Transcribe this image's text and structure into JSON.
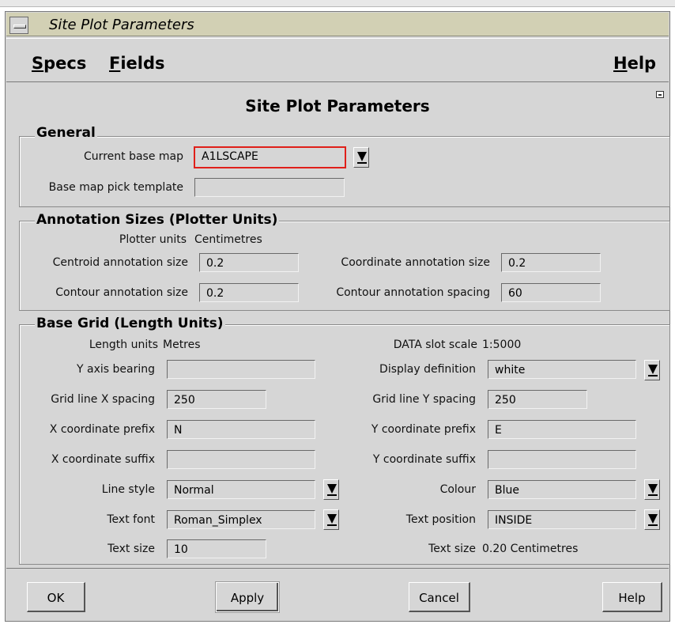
{
  "window": {
    "title": "Site Plot Parameters"
  },
  "menubar": {
    "specs": "Specs",
    "fields": "Fields",
    "help": "Help"
  },
  "heading": "Site Plot Parameters",
  "general": {
    "legend": "General",
    "current_base_map": {
      "label": "Current base map",
      "value": "A1LSCAPE"
    },
    "base_map_pick_template": {
      "label": "Base map pick template",
      "value": ""
    }
  },
  "annotation": {
    "legend": "Annotation Sizes (Plotter Units)",
    "plotter_units_label": "Plotter units",
    "plotter_units_value": "Centimetres",
    "centroid": {
      "label": "Centroid annotation size",
      "value": "0.2"
    },
    "coordinate": {
      "label": "Coordinate annotation size",
      "value": "0.2"
    },
    "contour_size": {
      "label": "Contour annotation size",
      "value": "0.2"
    },
    "contour_spacing": {
      "label": "Contour annotation spacing",
      "value": "60"
    }
  },
  "grid": {
    "legend": "Base Grid (Length Units)",
    "length_units_label": "Length units",
    "length_units_value": "Metres",
    "slot_scale_label": "DATA slot scale",
    "slot_scale_value": "1:5000",
    "y_axis_bearing": {
      "label": "Y axis bearing",
      "value": ""
    },
    "display_definition": {
      "label": "Display definition",
      "value": "white"
    },
    "x_spacing": {
      "label": "Grid line X spacing",
      "value": "250"
    },
    "y_spacing": {
      "label": "Grid line Y spacing",
      "value": "250"
    },
    "x_prefix": {
      "label": "X coordinate prefix",
      "value": "N"
    },
    "y_prefix": {
      "label": "Y coordinate prefix",
      "value": "E"
    },
    "x_suffix": {
      "label": "X coordinate suffix",
      "value": ""
    },
    "y_suffix": {
      "label": "Y coordinate suffix",
      "value": ""
    },
    "line_style": {
      "label": "Line style",
      "value": "Normal"
    },
    "colour": {
      "label": "Colour",
      "value": "Blue"
    },
    "text_font": {
      "label": "Text font",
      "value": "Roman_Simplex"
    },
    "text_position": {
      "label": "Text position",
      "value": "INSIDE"
    },
    "text_size": {
      "label": "Text size",
      "value": "10"
    },
    "text_size_info_label": "Text size",
    "text_size_info_value": "0.20 Centimetres"
  },
  "buttons": {
    "ok": "OK",
    "apply": "Apply",
    "cancel": "Cancel",
    "help": "Help"
  },
  "colors": {
    "highlight": "#e0201a",
    "titlebar": "#d2d0b4",
    "panel": "#d6d6d6"
  }
}
